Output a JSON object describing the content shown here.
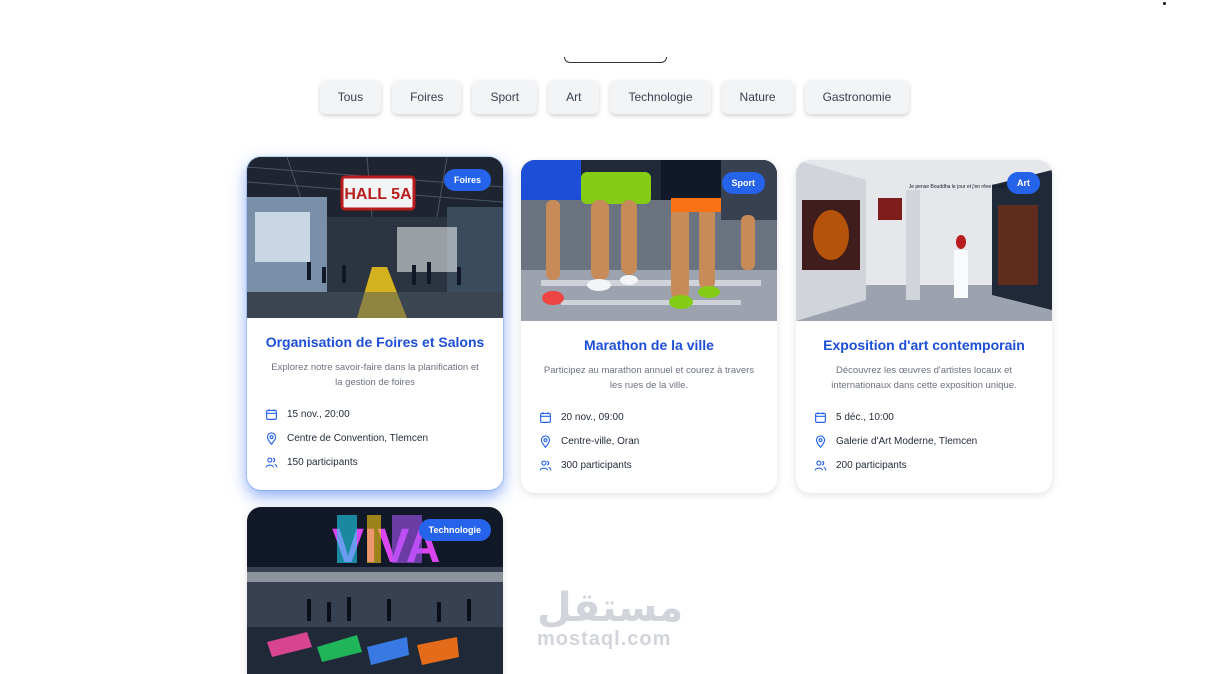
{
  "filters": [
    "Tous",
    "Foires",
    "Sport",
    "Art",
    "Technologie",
    "Nature",
    "Gastronomie"
  ],
  "cards": [
    {
      "badge": "Foires",
      "title": "Organisation de Foires et Salons",
      "description": "Explorez notre savoir-faire dans la planification et la gestion de foires",
      "date": "15 nov., 20:00",
      "location": "Centre de Convention, Tlemcen",
      "participants": "150 participants",
      "image_sign": "HALL 5A"
    },
    {
      "badge": "Sport",
      "title": "Marathon de la ville",
      "description": "Participez au marathon annuel et courez à travers les rues de la ville.",
      "date": "20 nov., 09:00",
      "location": "Centre-ville, Oran",
      "participants": "300 participants"
    },
    {
      "badge": "Art",
      "title": "Exposition d'art contemporain",
      "description": "Découvrez les œuvres d'artistes locaux et internationaux dans cette exposition unique.",
      "date": "5 déc., 10:00",
      "location": "Galerie d'Art Moderne, Tlemcen",
      "participants": "200 participants",
      "image_wall_text": "Je pense Bouddha le jour et j'en rêve la nuit."
    },
    {
      "badge": "Technologie",
      "image_sign": "VIVA"
    }
  ],
  "watermark": {
    "arabic": "مستقل",
    "latin": "mostaql.com"
  },
  "colors": {
    "accent": "#2563eb",
    "title": "#1d4ed8",
    "filter_bg": "#f3f4f6"
  }
}
